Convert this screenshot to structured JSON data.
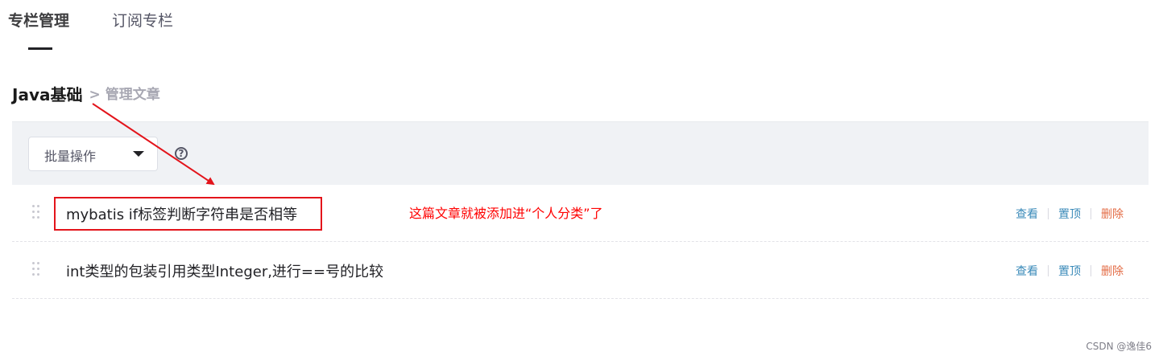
{
  "tabs": [
    {
      "label": "专栏管理",
      "active": true
    },
    {
      "label": "订阅专栏",
      "active": false
    }
  ],
  "breadcrumb": {
    "column": "Java基础",
    "separator": ">",
    "current": "管理文章"
  },
  "toolbar": {
    "batch_label": "批量操作",
    "help_glyph": "?"
  },
  "articles": [
    {
      "title": "mybatis if标签判断字符串是否相等",
      "view": "查看",
      "pin": "置顶",
      "delete": "删除"
    },
    {
      "title": "int类型的包装引用类型Integer,进行==号的比较",
      "view": "查看",
      "pin": "置顶",
      "delete": "删除"
    }
  ],
  "annotation": {
    "text": "这篇文章就被添加进“个人分类”了",
    "color": "#ff0000"
  },
  "watermark": "CSDN @逸佳6",
  "colors": {
    "link": "#3a8ab9",
    "danger": "#e36b44",
    "toolbar_bg": "#f0f2f5"
  }
}
